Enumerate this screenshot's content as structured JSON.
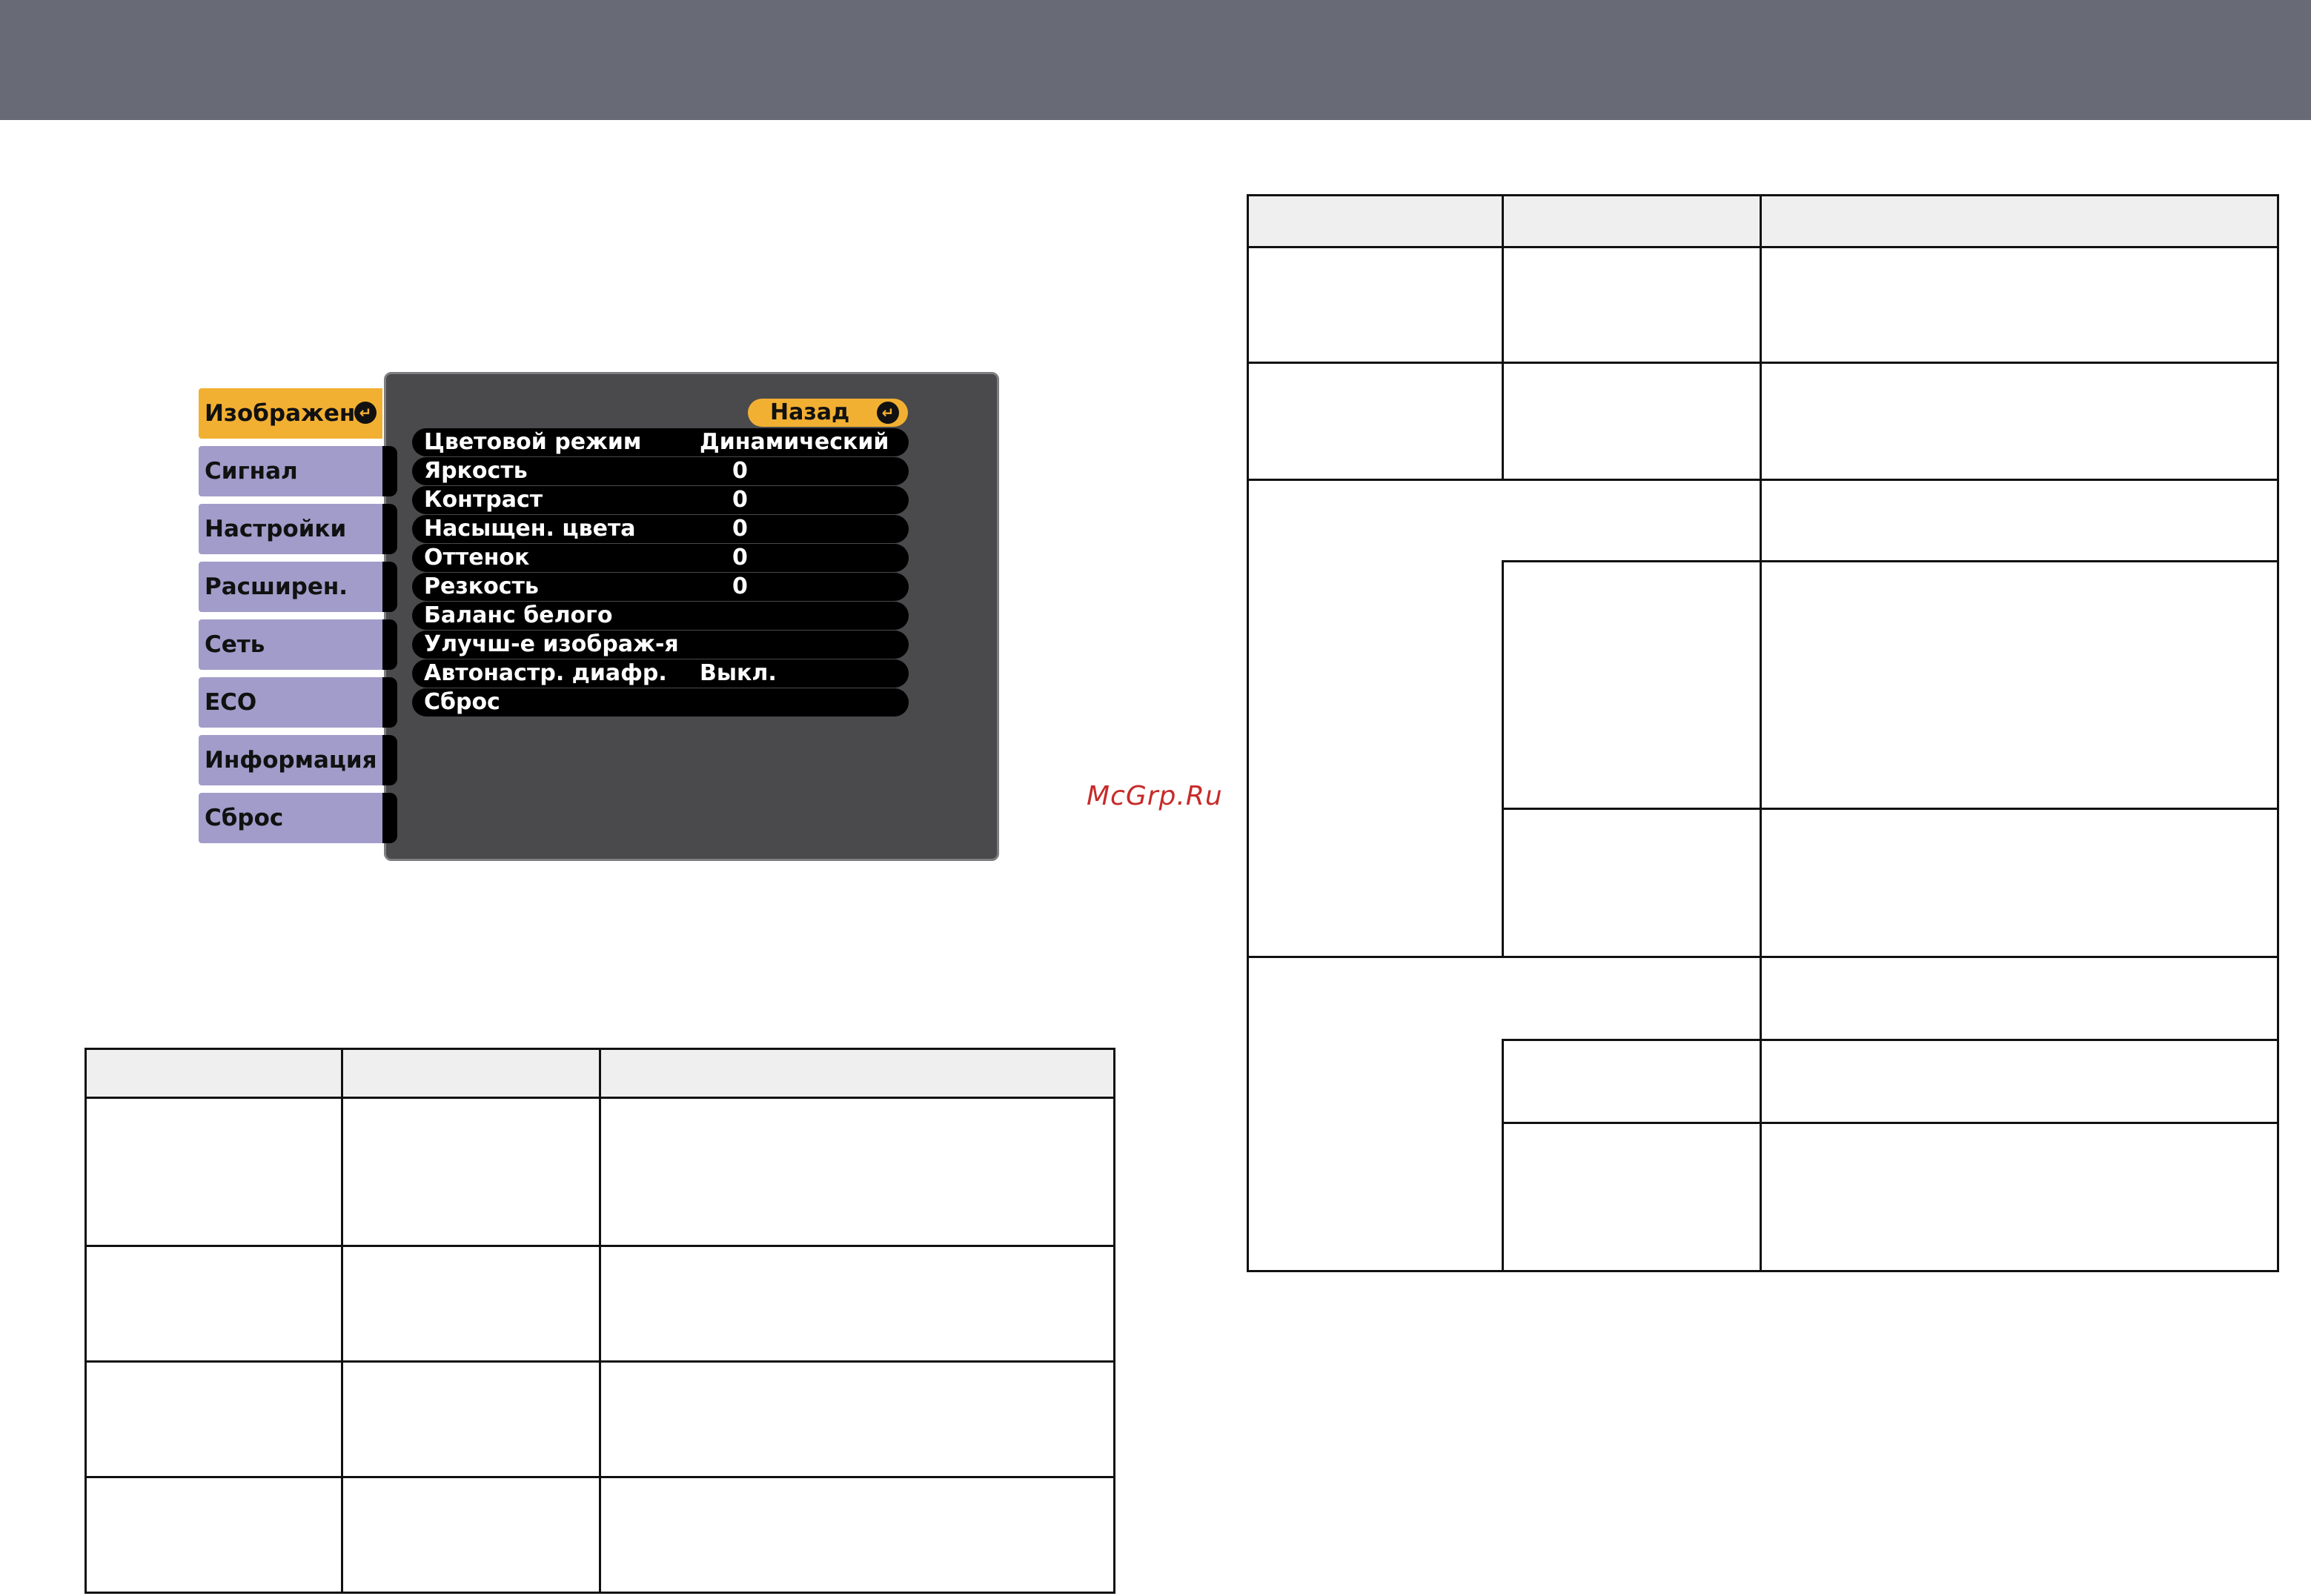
{
  "watermark": "McGrp.Ru",
  "menu": {
    "tabs": [
      {
        "label": "Изображен.",
        "active": true
      },
      {
        "label": "Сигнал",
        "active": false
      },
      {
        "label": "Настройки",
        "active": false
      },
      {
        "label": "Расширен.",
        "active": false
      },
      {
        "label": "Сеть",
        "active": false
      },
      {
        "label": "ECO",
        "active": false
      },
      {
        "label": "Информация",
        "active": false
      },
      {
        "label": "Сброс",
        "active": false
      }
    ],
    "back_label": "Назад",
    "items": [
      {
        "label": "Цветовой режим",
        "value": "Динамический"
      },
      {
        "label": "Яркость",
        "value": "0"
      },
      {
        "label": "Контраст",
        "value": "0"
      },
      {
        "label": "Насыщен. цвета",
        "value": "0"
      },
      {
        "label": "Оттенок",
        "value": "0"
      },
      {
        "label": "Резкость",
        "value": "0"
      },
      {
        "label": "Баланс белого",
        "value": ""
      },
      {
        "label": "Улучш-е изображ-я",
        "value": ""
      },
      {
        "label": "Автонастр. диафр.",
        "value": "Выкл."
      },
      {
        "label": "Сброс",
        "value": ""
      }
    ],
    "colors": {
      "active_tab": "#f2b032",
      "tab": "#a19cc9",
      "panel": "#4a4a4c",
      "header_bar": "#686a75"
    }
  }
}
